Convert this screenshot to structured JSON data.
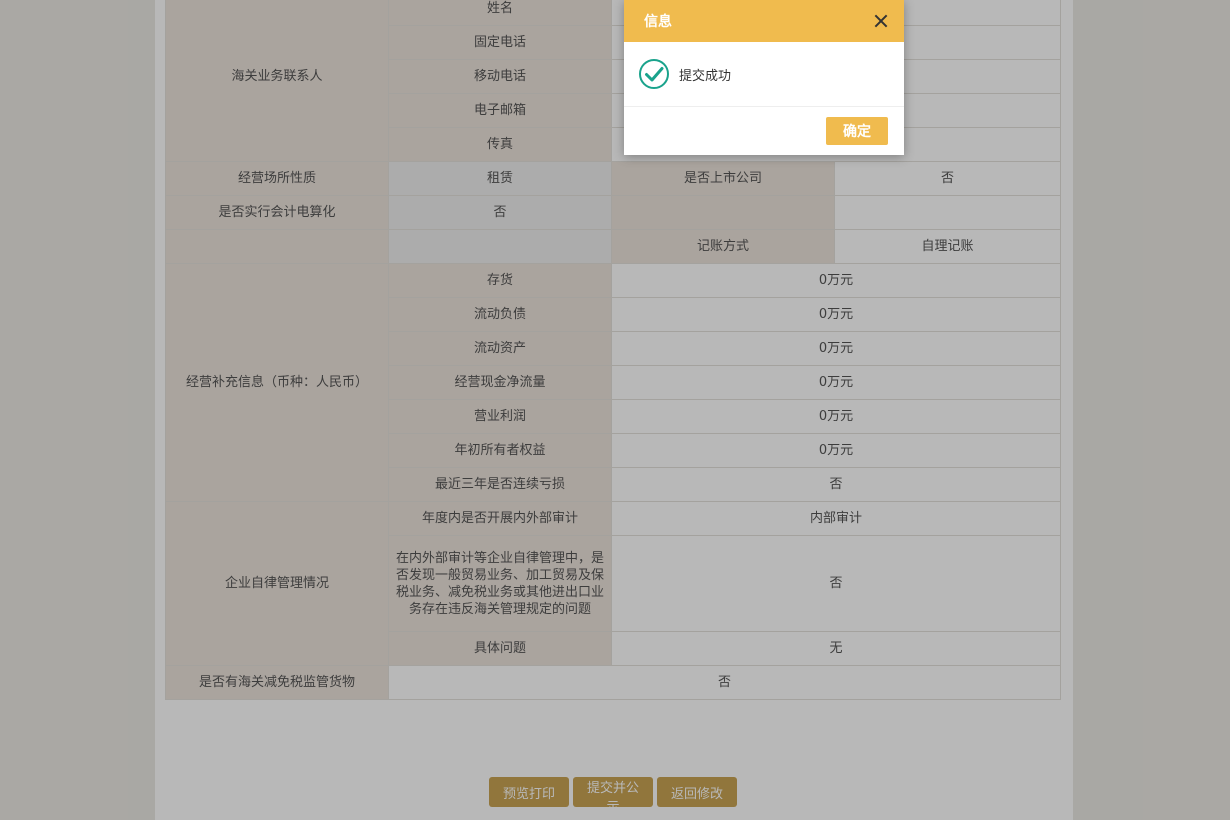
{
  "contact": {
    "group_label": "海关业务联系人",
    "fields": [
      "姓名",
      "固定电话",
      "移动电话",
      "电子邮箱",
      "传真"
    ]
  },
  "premises": {
    "label": "经营场所性质",
    "value": "租赁",
    "listed_label": "是否上市公司",
    "listed_value": "否"
  },
  "accounting": {
    "label": "是否实行会计电算化",
    "value": "否",
    "method_label": "记账方式",
    "method_value": "自理记账"
  },
  "supplement": {
    "group_label": "经营补充信息（币种：人民币）",
    "rows": [
      {
        "label": "存货",
        "value": "0万元"
      },
      {
        "label": "流动负债",
        "value": "0万元"
      },
      {
        "label": "流动资产",
        "value": "0万元"
      },
      {
        "label": "经营现金净流量",
        "value": "0万元"
      },
      {
        "label": "营业利润",
        "value": "0万元"
      },
      {
        "label": "年初所有者权益",
        "value": "0万元"
      },
      {
        "label": "最近三年是否连续亏损",
        "value": "否"
      }
    ]
  },
  "self_discipline": {
    "group_label": "企业自律管理情况",
    "rows": [
      {
        "label": "年度内是否开展内外部审计",
        "value": "内部审计"
      },
      {
        "label": "在内外部审计等企业自律管理中，是否发现一般贸易业务、加工贸易及保税业务、减免税业务或其他进出口业务存在违反海关管理规定的问题",
        "value": "否"
      },
      {
        "label": "具体问题",
        "value": "无"
      }
    ]
  },
  "bonded_goods": {
    "label": "是否有海关减免税监管货物",
    "value": "否"
  },
  "buttons": {
    "preview": "预览打印",
    "submit": "提交并公示",
    "back": "返回修改"
  },
  "dialog": {
    "title": "信息",
    "message": "提交成功",
    "confirm": "确定",
    "icon": "check-circle-icon"
  },
  "colors": {
    "accent": "#f0bb4e",
    "button": "#c9a454",
    "label_bg": "#ece4dc"
  }
}
